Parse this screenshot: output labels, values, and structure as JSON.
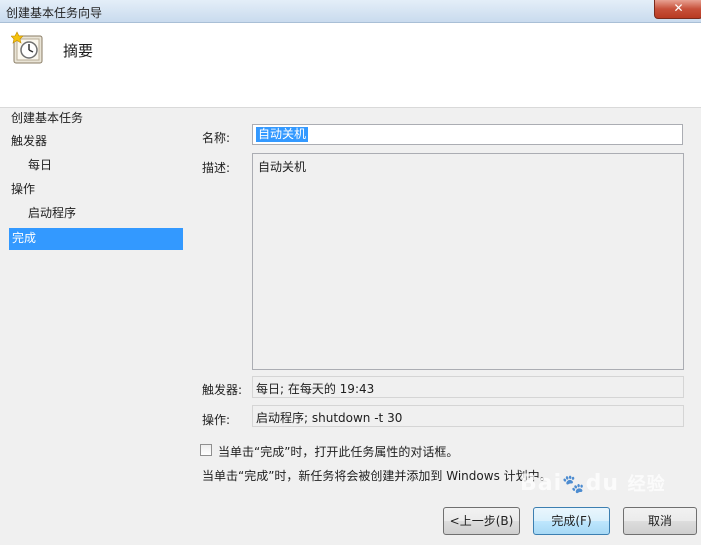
{
  "window": {
    "title": "创建基本任务向导",
    "close_glyph": "✕"
  },
  "header": {
    "title": "摘要"
  },
  "nav": {
    "items": [
      "创建基本任务",
      "触发器",
      "每日",
      "操作",
      "启动程序",
      "完成"
    ],
    "selected": "完成"
  },
  "form": {
    "name_label": "名称:",
    "name_value": "自动关机",
    "desc_label": "描述:",
    "desc_value": "自动关机",
    "trigger_label": "触发器:",
    "trigger_value": "每日; 在每天的 19:43",
    "action_label": "操作:",
    "action_value": "启动程序; shutdown -t 30",
    "checkbox_label": "当单击“完成”时，打开此任务属性的对话框。",
    "checkbox_checked": false,
    "info_text": "当单击“完成”时，新任务将会被创建并添加到 Windows 计划中。"
  },
  "buttons": {
    "back": "<上一步(B)",
    "finish": "完成(F)",
    "cancel": "取消"
  },
  "watermark": {
    "text": "Bai",
    "text2": "du",
    "text3": "经验"
  },
  "colors": {
    "selection": "#3399ff",
    "background": "#f0f0f0"
  },
  "icons": {
    "header": "task-clock-icon",
    "close": "close-icon",
    "checkbox": "checkbox-icon"
  }
}
